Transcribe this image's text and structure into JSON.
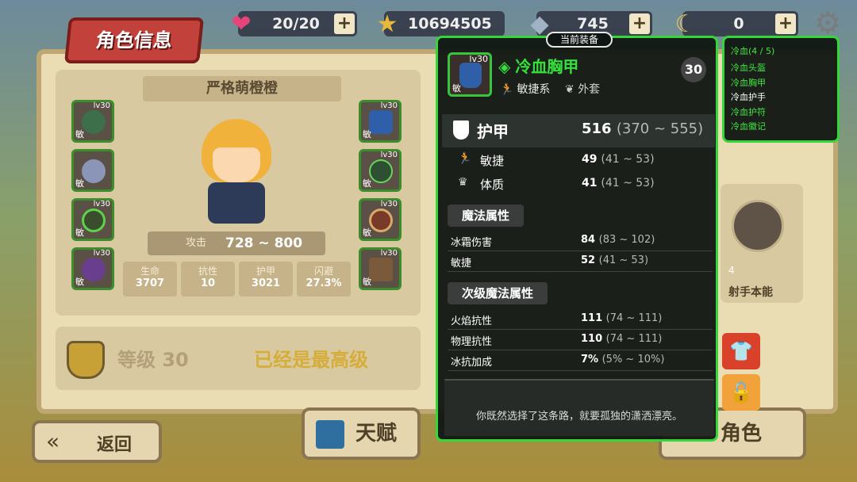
{
  "resources": [
    {
      "icon": "heart-icon",
      "value": "20/20"
    },
    {
      "icon": "star-icon",
      "value": "10694505"
    },
    {
      "icon": "gem-icon",
      "value": "745"
    },
    {
      "icon": "moon-icon",
      "value": "0"
    }
  ],
  "panel_title": "角色信息",
  "character": {
    "name": "严格萌橙橙",
    "left_slots": [
      {
        "level": "lv30",
        "tag": "敏"
      },
      {
        "level": "",
        "tag": "敏"
      },
      {
        "level": "lv30",
        "tag": "敏"
      },
      {
        "level": "lv30",
        "tag": "敏"
      }
    ],
    "right_slots": [
      {
        "level": "lv30",
        "tag": "敏"
      },
      {
        "level": "lv30",
        "tag": "敏"
      },
      {
        "level": "lv30",
        "tag": "敏"
      },
      {
        "level": "lv30",
        "tag": "敏"
      }
    ],
    "attack_label": "攻击",
    "attack_value": "728 ~ 800",
    "stats": [
      {
        "label": "生命",
        "value": "3707"
      },
      {
        "label": "抗性",
        "value": "10"
      },
      {
        "label": "护甲",
        "value": "3021"
      },
      {
        "label": "闪避",
        "value": "27.3%"
      }
    ],
    "level_label": "等级 30",
    "max_label": "已经是最高级"
  },
  "back_label": "返回",
  "tabs": [
    {
      "label": "天赋"
    },
    {
      "label": "角色"
    }
  ],
  "side_card": {
    "number": "4",
    "label": "射手本能"
  },
  "tooltip": {
    "header": "当前装备",
    "item_level_badge": "lv30",
    "item_tag": "敏",
    "item_name": "冷血胸甲",
    "item_class": "敏捷系",
    "item_slot": "外套",
    "item_level": "30",
    "armor_label": "护甲",
    "armor_value": "516",
    "armor_range": "(370 ~ 555)",
    "base_rows": [
      {
        "label": "敏捷",
        "value": "49",
        "range": "(41 ~ 53)"
      },
      {
        "label": "体质",
        "value": "41",
        "range": "(41 ~ 53)"
      }
    ],
    "magic_title": "魔法属性",
    "magic_rows": [
      {
        "label": "冰霜伤害",
        "value": "84",
        "range": "(83 ~ 102)"
      },
      {
        "label": "敏捷",
        "value": "52",
        "range": "(41 ~ 53)"
      }
    ],
    "secondary_title": "次级魔法属性",
    "secondary_rows": [
      {
        "label": "火焰抗性",
        "value": "111",
        "range": "(74 ~ 111)"
      },
      {
        "label": "物理抗性",
        "value": "110",
        "range": "(74 ~ 111)"
      },
      {
        "label": "冰抗加成",
        "value": "7%",
        "range": "(5% ~ 10%)"
      }
    ],
    "description": "你既然选择了这条路，就要孤独的潇洒漂亮。"
  },
  "set_panel": {
    "title": "冷血(4 / 5)",
    "items": [
      {
        "name": "冷血头盔",
        "equipped": true
      },
      {
        "name": "冷血胸甲",
        "equipped": true
      },
      {
        "name": "冷血护手",
        "equipped": false
      },
      {
        "name": "冷血护符",
        "equipped": true
      },
      {
        "name": "冷血徽记",
        "equipped": true
      }
    ]
  },
  "colors": {
    "rarity_green": "#35d63a",
    "tooltip_bg": "#111713",
    "panel_beige": "#eadcb3",
    "ribbon_red": "#c2413a",
    "max_gold": "#d6ad38"
  }
}
